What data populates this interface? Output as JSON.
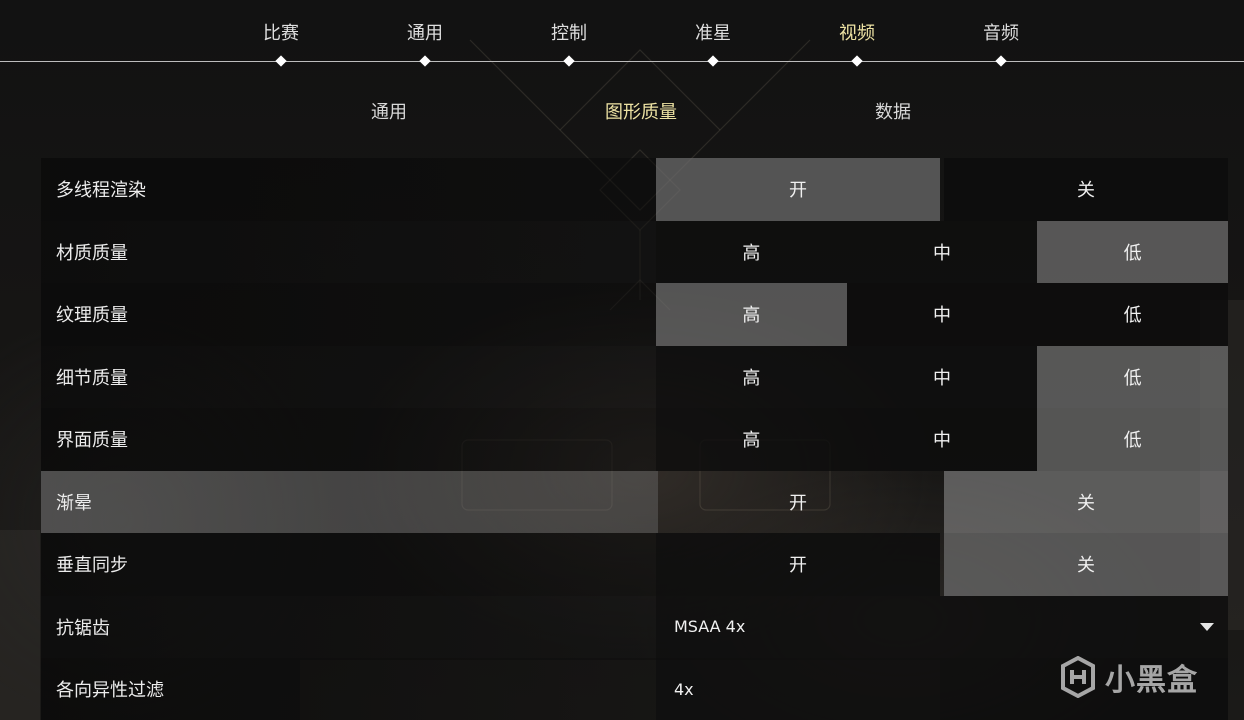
{
  "top_tabs": [
    "比赛",
    "通用",
    "控制",
    "准星",
    "视频",
    "音频"
  ],
  "top_active": "视频",
  "sub_tabs": [
    "通用",
    "图形质量",
    "数据"
  ],
  "sub_active": "图形质量",
  "rows": [
    {
      "label": "多线程渲染",
      "type": "toggle",
      "options": [
        "开",
        "关"
      ],
      "selected": "开"
    },
    {
      "label": "材质质量",
      "type": "triple",
      "options": [
        "高",
        "中",
        "低"
      ],
      "selected": "低"
    },
    {
      "label": "纹理质量",
      "type": "triple",
      "options": [
        "高",
        "中",
        "低"
      ],
      "selected": "高"
    },
    {
      "label": "细节质量",
      "type": "triple",
      "options": [
        "高",
        "中",
        "低"
      ],
      "selected": "低"
    },
    {
      "label": "界面质量",
      "type": "triple",
      "options": [
        "高",
        "中",
        "低"
      ],
      "selected": "低"
    },
    {
      "label": "渐晕",
      "type": "toggle",
      "options": [
        "开",
        "关"
      ],
      "selected": "关"
    },
    {
      "label": "垂直同步",
      "type": "toggle",
      "options": [
        "开",
        "关"
      ],
      "selected": "关"
    },
    {
      "label": "抗锯齿",
      "type": "dropdown",
      "value": "MSAA 4x"
    },
    {
      "label": "各向异性过滤",
      "type": "dropdown",
      "value": "4x"
    }
  ],
  "watermark": {
    "text": "小黑盒",
    "icon": "heybox-logo-icon"
  },
  "colors": {
    "active_tab": "#ede2a3",
    "selected_option": "#6e6e6e",
    "divider": "#bdbdbd"
  }
}
